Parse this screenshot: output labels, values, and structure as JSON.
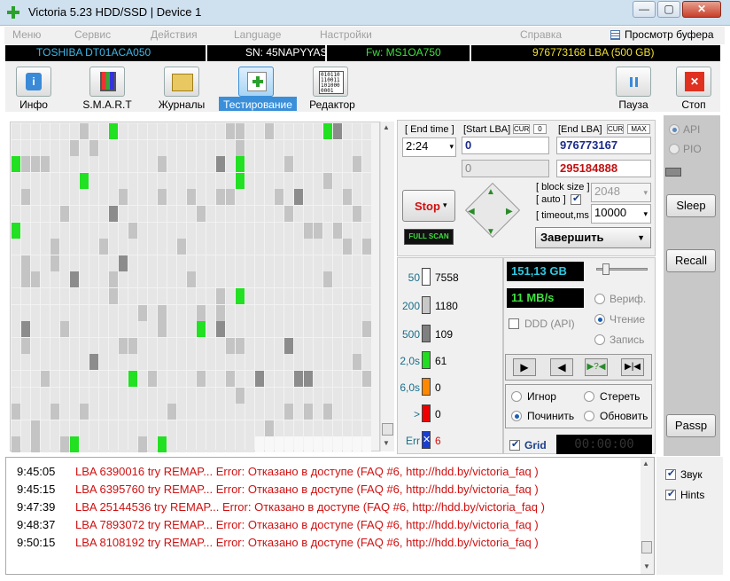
{
  "window": {
    "title": "Victoria 5.23 HDD/SSD | Device 1",
    "min": "—",
    "max": "▢",
    "close": "✕"
  },
  "menu": {
    "items": [
      "Меню",
      "Сервис",
      "Действия",
      "Language",
      "Настройки",
      "Справка"
    ],
    "buffer": "Просмотр буфера"
  },
  "device": {
    "model": "TOSHIBA DT01ACA050",
    "serial": "SN: 45NAPYYAS",
    "firmware": "Fw: MS1OA750",
    "capacity": "976773168 LBA (500 GB)"
  },
  "toolbar": {
    "info": "Инфо",
    "smart": "S.M.A.R.T",
    "logs": "Журналы",
    "test": "Тестирование",
    "editor": "Редактор",
    "pause": "Пауза",
    "stop": "Стоп"
  },
  "test": {
    "end_time_label": "[ End time ]",
    "end_time": "2:24",
    "start_lba_label": "[Start LBA]",
    "cur": "CUR",
    "zero": "0",
    "start_lba": "0",
    "start_lba2": "0",
    "end_lba_label": "[End LBA]",
    "max": "MAX",
    "end_lba": "976773167",
    "end_lba2": "295184888",
    "stop_btn": "Stop",
    "full_scan": "FULL SCAN",
    "block_size_label": "[ block size ]",
    "auto_label": "[ auto ]",
    "block_size": "2048",
    "timeout_label": "[ timeout,ms ]",
    "timeout": "10000",
    "finish": "Завершить"
  },
  "legend": [
    {
      "label": "50",
      "value": "7558",
      "color": "#ffffff"
    },
    {
      "label": "200",
      "value": "1180",
      "color": "#c8c8c8"
    },
    {
      "label": "500",
      "value": "109",
      "color": "#808080"
    },
    {
      "label": "2,0s",
      "value": "61",
      "color": "#22dd22"
    },
    {
      "label": "6,0s",
      "value": "0",
      "color": "#ff8800"
    },
    {
      "label": ">",
      "value": "0",
      "color": "#ee0000"
    },
    {
      "label": "Err",
      "value": "6",
      "color": "#1a3fd0"
    }
  ],
  "progress": {
    "size": "151,13 GB",
    "speed": "11 MB/s",
    "ddd": "DDD (API)",
    "verify": "Вериф.",
    "read": "Чтение",
    "write": "Запись",
    "ignore": "Игнор",
    "erase": "Стереть",
    "repair": "Починить",
    "refresh": "Обновить",
    "grid": "Grid",
    "timer": "00:00:00"
  },
  "side": {
    "api": "API",
    "pio": "PIO",
    "sleep": "Sleep",
    "recall": "Recall",
    "passp": "Passp",
    "sound": "Звук",
    "hints": "Hints"
  },
  "log": [
    {
      "time": "9:45:05",
      "msg": "LBA 6390016 try REMAP... Error: Отказано в доступе (FAQ #6, http://hdd.by/victoria_faq )"
    },
    {
      "time": "9:45:15",
      "msg": "LBA 6395760 try REMAP... Error: Отказано в доступе (FAQ #6, http://hdd.by/victoria_faq )"
    },
    {
      "time": "9:47:39",
      "msg": "LBA 25144536 try REMAP... Error: Отказано в доступе (FAQ #6, http://hdd.by/victoria_faq )"
    },
    {
      "time": "9:48:37",
      "msg": "LBA 7893072 try REMAP... Error: Отказано в доступе (FAQ #6, http://hdd.by/victoria_faq )"
    },
    {
      "time": "9:50:15",
      "msg": "LBA 8108192 try REMAP... Error: Отказано в доступе (FAQ #6, http://hdd.by/victoria_faq )"
    }
  ]
}
